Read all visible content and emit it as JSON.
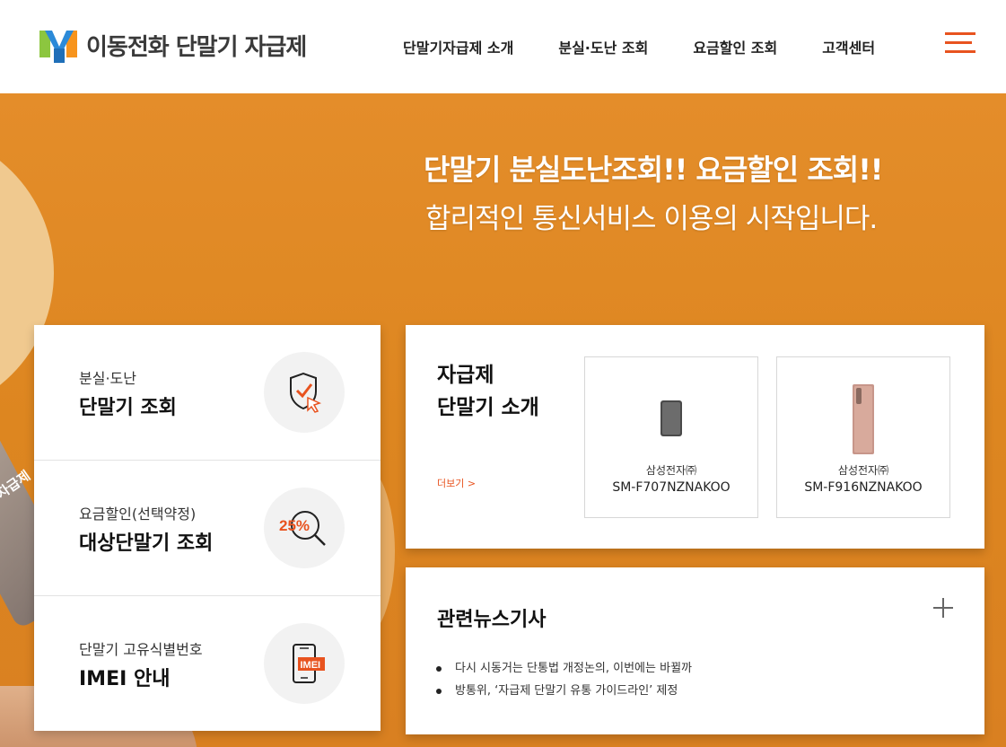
{
  "header": {
    "logo_text": "이동전화 단말기 자급제",
    "nav": [
      "단말기자급제 소개",
      "분실·도난 조회",
      "요금할인 조회",
      "고객센터"
    ]
  },
  "hero": {
    "title": "단말기 분실도난조회!! 요금할인 조회!!",
    "subtitle": "합리적인 통신서비스 이용의 시작입니다.",
    "phone_text": "자급제"
  },
  "services": [
    {
      "small": "분실·도난",
      "big": "단말기 조회",
      "icon": "shield-check-cursor-icon"
    },
    {
      "small": "요금할인(선택약정)",
      "big": "대상단말기 조회",
      "icon": "percent-search-icon",
      "icon_text": "25%"
    },
    {
      "small": "단말기 고유식별번호",
      "big": "IMEI 안내",
      "icon": "phone-imei-icon",
      "icon_text": "IMEI"
    }
  ],
  "devices": {
    "title_line1": "자급제",
    "title_line2": "단말기 소개",
    "more": "더보기 >",
    "items": [
      {
        "brand": "삼성전자㈜",
        "model": "SM-F707NZNAKOO"
      },
      {
        "brand": "삼성전자㈜",
        "model": "SM-F916NZNAKOO"
      }
    ]
  },
  "news": {
    "title": "관련뉴스기사",
    "items": [
      "다시 시동거는 단통법 개정논의, 이번에는 바뀔까",
      "방통위, ‘자급제 단말기 유통 가이드라인’ 제정"
    ]
  },
  "colors": {
    "accent": "#e8531f",
    "hero_bg": "#dd8620"
  }
}
